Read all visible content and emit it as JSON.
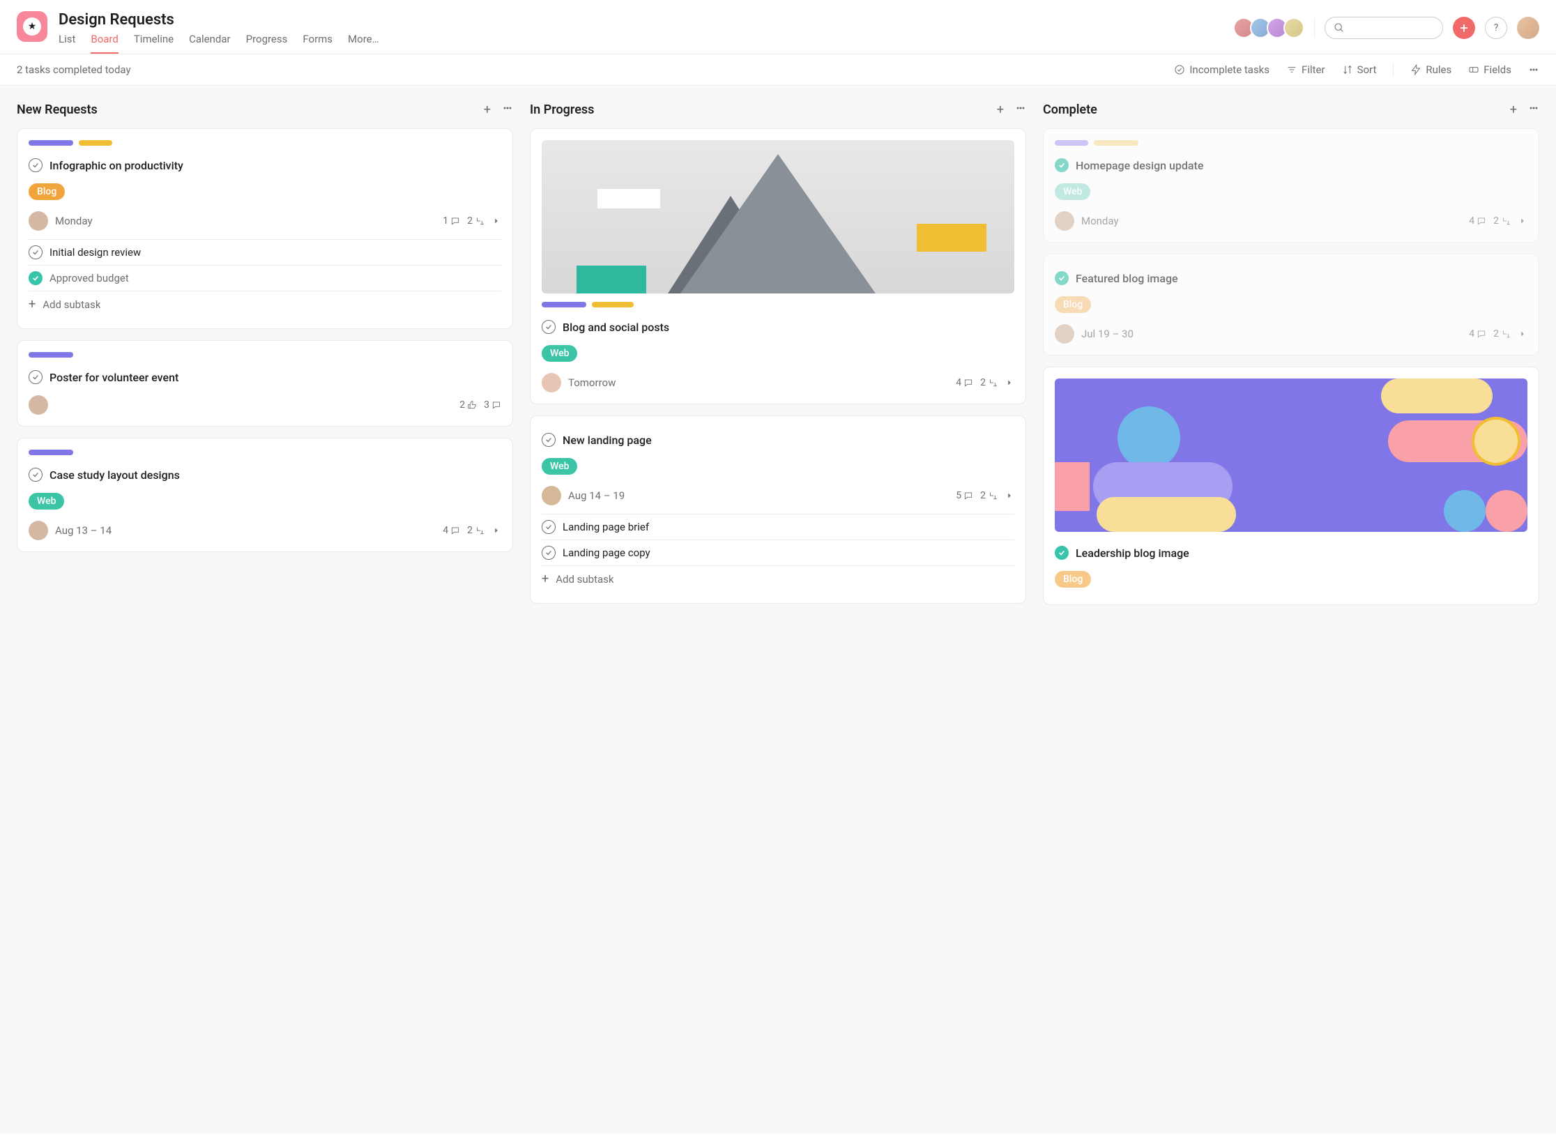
{
  "project": {
    "title": "Design Requests"
  },
  "tabs": {
    "list": "List",
    "board": "Board",
    "timeline": "Timeline",
    "calendar": "Calendar",
    "progress": "Progress",
    "forms": "Forms",
    "more": "More…"
  },
  "toolbar": {
    "status": "2 tasks completed today",
    "incomplete": "Incomplete tasks",
    "filter": "Filter",
    "sort": "Sort",
    "rules": "Rules",
    "fields": "Fields"
  },
  "columns": {
    "new": {
      "title": "New Requests"
    },
    "progress": {
      "title": "In Progress"
    },
    "complete": {
      "title": "Complete"
    }
  },
  "pills": {
    "blog": "Blog",
    "web": "Web"
  },
  "subtask_add": "Add subtask",
  "cards": {
    "c1": {
      "title": "Infographic on productivity",
      "date": "Monday",
      "comments": "1",
      "subtasks_count": "2",
      "sub1": "Initial design review",
      "sub2": "Approved budget"
    },
    "c2": {
      "title": "Poster for volunteer event",
      "likes": "2",
      "comments": "3"
    },
    "c3": {
      "title": "Case study layout designs",
      "date": "Aug 13 – 14",
      "comments": "4",
      "subtasks_count": "2"
    },
    "c4": {
      "title": "Blog and social posts",
      "date": "Tomorrow",
      "comments": "4",
      "subtasks_count": "2"
    },
    "c5": {
      "title": "New landing page",
      "date": "Aug 14 – 19",
      "comments": "5",
      "subtasks_count": "2",
      "sub1": "Landing page brief",
      "sub2": "Landing page copy"
    },
    "c6": {
      "title": "Homepage design update",
      "date": "Monday",
      "comments": "4",
      "subtasks_count": "2"
    },
    "c7": {
      "title": "Featured blog image",
      "date": "Jul 19 – 30",
      "comments": "4",
      "subtasks_count": "2"
    },
    "c8": {
      "title": "Leadership blog image"
    }
  }
}
